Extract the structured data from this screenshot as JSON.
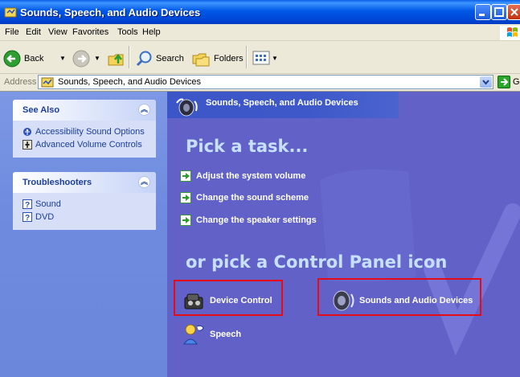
{
  "window": {
    "title": "Sounds, Speech, and Audio Devices",
    "controls": [
      "minimize-icon",
      "maximize-icon",
      "close-icon"
    ]
  },
  "menubar": {
    "items": [
      {
        "label": "File"
      },
      {
        "label": "Edit"
      },
      {
        "label": "View"
      },
      {
        "label": "Favorites"
      },
      {
        "label": "Tools"
      },
      {
        "label": "Help"
      }
    ]
  },
  "toolbar": {
    "back": "Back",
    "search": "Search",
    "folders": "Folders"
  },
  "address": {
    "label": "Address",
    "value": "Sounds, Speech, and Audio Devices",
    "go": "Go"
  },
  "sidebar": {
    "see_also": {
      "title": "See Also",
      "links": [
        "Accessibility Sound Options",
        "Advanced Volume Controls"
      ]
    },
    "troubleshooters": {
      "title": "Troubleshooters",
      "links": [
        "Sound",
        "DVD"
      ]
    }
  },
  "main": {
    "header": "Sounds, Speech, and Audio Devices",
    "pick_task": "Pick a task...",
    "tasks": [
      "Adjust the system volume",
      "Change the sound scheme",
      "Change the speaker settings"
    ],
    "pick_icon": "or pick a Control Panel icon",
    "icons": [
      {
        "label": "Device Control",
        "icon": "device-control-icon"
      },
      {
        "label": "Sounds and Audio Devices",
        "icon": "speaker-icon"
      },
      {
        "label": "Speech",
        "icon": "speech-icon"
      }
    ]
  },
  "colors": {
    "title_bar": "#0058e6",
    "main_background": "#6161c8",
    "sidebar_background": "#7c98e4",
    "highlight_box": "#e60b17",
    "heading_text": "#c8e0ff"
  }
}
